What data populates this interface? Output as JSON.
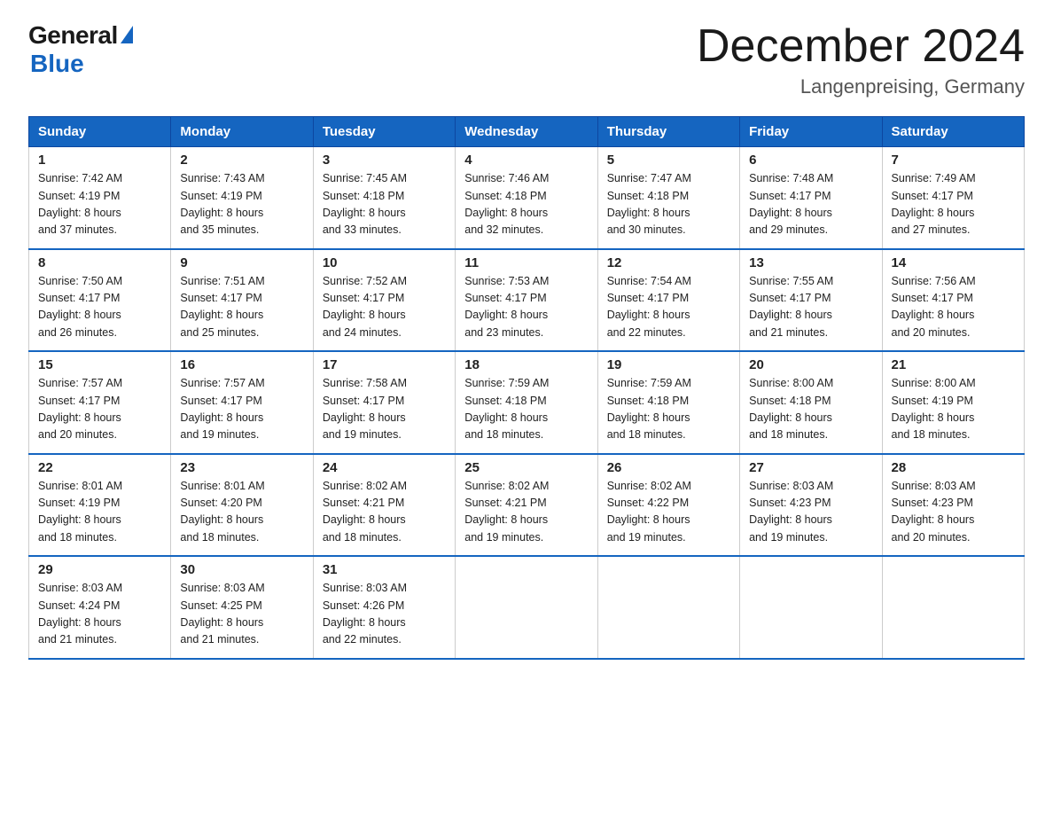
{
  "logo": {
    "general": "General",
    "blue": "Blue",
    "tagline": "Blue"
  },
  "header": {
    "month_year": "December 2024",
    "location": "Langenpreising, Germany"
  },
  "days_of_week": [
    "Sunday",
    "Monday",
    "Tuesday",
    "Wednesday",
    "Thursday",
    "Friday",
    "Saturday"
  ],
  "weeks": [
    [
      {
        "day": "1",
        "sunrise": "7:42 AM",
        "sunset": "4:19 PM",
        "daylight": "8 hours and 37 minutes."
      },
      {
        "day": "2",
        "sunrise": "7:43 AM",
        "sunset": "4:19 PM",
        "daylight": "8 hours and 35 minutes."
      },
      {
        "day": "3",
        "sunrise": "7:45 AM",
        "sunset": "4:18 PM",
        "daylight": "8 hours and 33 minutes."
      },
      {
        "day": "4",
        "sunrise": "7:46 AM",
        "sunset": "4:18 PM",
        "daylight": "8 hours and 32 minutes."
      },
      {
        "day": "5",
        "sunrise": "7:47 AM",
        "sunset": "4:18 PM",
        "daylight": "8 hours and 30 minutes."
      },
      {
        "day": "6",
        "sunrise": "7:48 AM",
        "sunset": "4:17 PM",
        "daylight": "8 hours and 29 minutes."
      },
      {
        "day": "7",
        "sunrise": "7:49 AM",
        "sunset": "4:17 PM",
        "daylight": "8 hours and 27 minutes."
      }
    ],
    [
      {
        "day": "8",
        "sunrise": "7:50 AM",
        "sunset": "4:17 PM",
        "daylight": "8 hours and 26 minutes."
      },
      {
        "day": "9",
        "sunrise": "7:51 AM",
        "sunset": "4:17 PM",
        "daylight": "8 hours and 25 minutes."
      },
      {
        "day": "10",
        "sunrise": "7:52 AM",
        "sunset": "4:17 PM",
        "daylight": "8 hours and 24 minutes."
      },
      {
        "day": "11",
        "sunrise": "7:53 AM",
        "sunset": "4:17 PM",
        "daylight": "8 hours and 23 minutes."
      },
      {
        "day": "12",
        "sunrise": "7:54 AM",
        "sunset": "4:17 PM",
        "daylight": "8 hours and 22 minutes."
      },
      {
        "day": "13",
        "sunrise": "7:55 AM",
        "sunset": "4:17 PM",
        "daylight": "8 hours and 21 minutes."
      },
      {
        "day": "14",
        "sunrise": "7:56 AM",
        "sunset": "4:17 PM",
        "daylight": "8 hours and 20 minutes."
      }
    ],
    [
      {
        "day": "15",
        "sunrise": "7:57 AM",
        "sunset": "4:17 PM",
        "daylight": "8 hours and 20 minutes."
      },
      {
        "day": "16",
        "sunrise": "7:57 AM",
        "sunset": "4:17 PM",
        "daylight": "8 hours and 19 minutes."
      },
      {
        "day": "17",
        "sunrise": "7:58 AM",
        "sunset": "4:17 PM",
        "daylight": "8 hours and 19 minutes."
      },
      {
        "day": "18",
        "sunrise": "7:59 AM",
        "sunset": "4:18 PM",
        "daylight": "8 hours and 18 minutes."
      },
      {
        "day": "19",
        "sunrise": "7:59 AM",
        "sunset": "4:18 PM",
        "daylight": "8 hours and 18 minutes."
      },
      {
        "day": "20",
        "sunrise": "8:00 AM",
        "sunset": "4:18 PM",
        "daylight": "8 hours and 18 minutes."
      },
      {
        "day": "21",
        "sunrise": "8:00 AM",
        "sunset": "4:19 PM",
        "daylight": "8 hours and 18 minutes."
      }
    ],
    [
      {
        "day": "22",
        "sunrise": "8:01 AM",
        "sunset": "4:19 PM",
        "daylight": "8 hours and 18 minutes."
      },
      {
        "day": "23",
        "sunrise": "8:01 AM",
        "sunset": "4:20 PM",
        "daylight": "8 hours and 18 minutes."
      },
      {
        "day": "24",
        "sunrise": "8:02 AM",
        "sunset": "4:21 PM",
        "daylight": "8 hours and 18 minutes."
      },
      {
        "day": "25",
        "sunrise": "8:02 AM",
        "sunset": "4:21 PM",
        "daylight": "8 hours and 19 minutes."
      },
      {
        "day": "26",
        "sunrise": "8:02 AM",
        "sunset": "4:22 PM",
        "daylight": "8 hours and 19 minutes."
      },
      {
        "day": "27",
        "sunrise": "8:03 AM",
        "sunset": "4:23 PM",
        "daylight": "8 hours and 19 minutes."
      },
      {
        "day": "28",
        "sunrise": "8:03 AM",
        "sunset": "4:23 PM",
        "daylight": "8 hours and 20 minutes."
      }
    ],
    [
      {
        "day": "29",
        "sunrise": "8:03 AM",
        "sunset": "4:24 PM",
        "daylight": "8 hours and 21 minutes."
      },
      {
        "day": "30",
        "sunrise": "8:03 AM",
        "sunset": "4:25 PM",
        "daylight": "8 hours and 21 minutes."
      },
      {
        "day": "31",
        "sunrise": "8:03 AM",
        "sunset": "4:26 PM",
        "daylight": "8 hours and 22 minutes."
      },
      null,
      null,
      null,
      null
    ]
  ],
  "labels": {
    "sunrise": "Sunrise:",
    "sunset": "Sunset:",
    "daylight": "Daylight:"
  }
}
